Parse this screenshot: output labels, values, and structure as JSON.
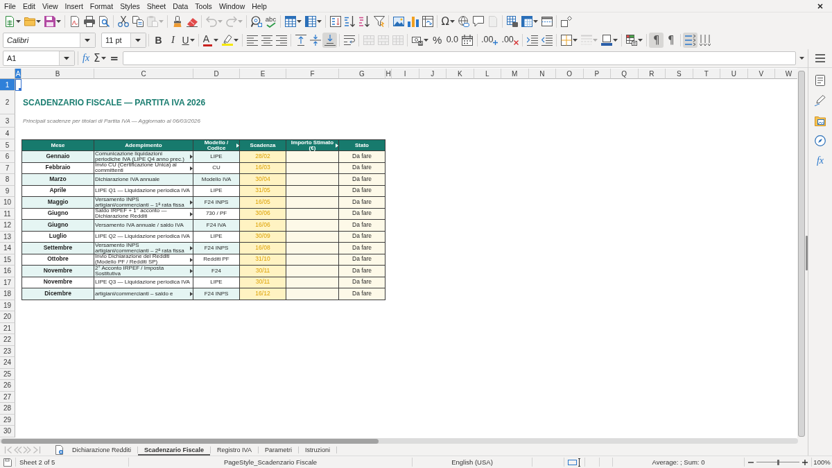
{
  "menu": [
    "File",
    "Edit",
    "View",
    "Insert",
    "Format",
    "Styles",
    "Sheet",
    "Data",
    "Tools",
    "Window",
    "Help"
  ],
  "standard_toolbar": [
    [
      {
        "kind": "new",
        "dropdown": true,
        "disabled": false,
        "on": false
      },
      {
        "kind": "open",
        "dropdown": true,
        "disabled": false,
        "on": false
      },
      {
        "kind": "save",
        "dropdown": true,
        "disabled": false,
        "on": false
      }
    ],
    [
      {
        "kind": "pdf",
        "disabled": false,
        "on": false
      },
      {
        "kind": "print",
        "disabled": false,
        "on": false
      },
      {
        "kind": "preview",
        "disabled": false,
        "on": false
      }
    ],
    [
      {
        "kind": "cut",
        "disabled": false,
        "on": false
      },
      {
        "kind": "copy",
        "disabled": false,
        "on": false
      },
      {
        "kind": "paste",
        "dropdown": true,
        "disabled": true,
        "on": false
      }
    ],
    [
      {
        "kind": "clone",
        "disabled": false,
        "on": false
      },
      {
        "kind": "clear",
        "disabled": false,
        "on": false
      }
    ],
    [
      {
        "kind": "undo",
        "dropdown": true,
        "disabled": true,
        "on": false
      },
      {
        "kind": "redo",
        "dropdown": true,
        "disabled": true,
        "on": false
      }
    ],
    [
      {
        "kind": "find",
        "disabled": false,
        "on": false
      },
      {
        "kind": "spelling",
        "label": "abc",
        "disabled": false,
        "on": false
      }
    ],
    [
      {
        "kind": "rows",
        "dropdown": true,
        "disabled": false,
        "on": false
      },
      {
        "kind": "columns",
        "dropdown": true,
        "disabled": false,
        "on": false
      }
    ],
    [
      {
        "kind": "sort",
        "disabled": false,
        "on": false
      },
      {
        "kind": "sortasc",
        "disabled": false,
        "on": false
      },
      {
        "kind": "sortdesc",
        "disabled": false,
        "on": false
      },
      {
        "kind": "autofilter",
        "disabled": false,
        "on": false
      }
    ],
    [
      {
        "kind": "image",
        "disabled": false,
        "on": false
      },
      {
        "kind": "chart",
        "disabled": false,
        "on": false
      },
      {
        "kind": "pivot",
        "disabled": false,
        "on": false
      }
    ],
    [
      {
        "kind": "special",
        "label": "Ω",
        "dropdown": true,
        "disabled": false,
        "on": false
      },
      {
        "kind": "hyperlink",
        "disabled": false,
        "on": false
      },
      {
        "kind": "comment",
        "disabled": false,
        "on": false
      },
      {
        "kind": "headerfooter",
        "disabled": true,
        "on": false
      }
    ],
    [
      {
        "kind": "printarea",
        "disabled": false,
        "on": false
      },
      {
        "kind": "freeze",
        "dropdown": true,
        "disabled": false,
        "on": false
      },
      {
        "kind": "split",
        "disabled": false,
        "on": false
      }
    ],
    [
      {
        "kind": "shapes",
        "disabled": false,
        "on": false
      }
    ]
  ],
  "formatting_toolbar": {
    "font_name": "Calibri",
    "font_size": "11 pt",
    "groups": [
      [
        {
          "kind": "bold",
          "label": "B",
          "disabled": false,
          "on": false
        },
        {
          "kind": "italic",
          "label": "I",
          "disabled": false,
          "on": false
        },
        {
          "kind": "underline",
          "label": "U",
          "dropdown": true,
          "disabled": false,
          "on": false
        }
      ],
      [
        {
          "kind": "fontcolor",
          "label": "A",
          "dropdown": true,
          "disabled": false,
          "on": false
        },
        {
          "kind": "highlight",
          "dropdown": true,
          "disabled": false,
          "on": false
        }
      ],
      [
        {
          "kind": "alignleft",
          "disabled": false,
          "on": false
        },
        {
          "kind": "aligncenter",
          "disabled": false,
          "on": false
        },
        {
          "kind": "alignright",
          "disabled": false,
          "on": false
        }
      ],
      [
        {
          "kind": "aligntop",
          "disabled": false,
          "on": false
        },
        {
          "kind": "alignmiddle",
          "disabled": false,
          "on": false
        },
        {
          "kind": "alignbottom",
          "disabled": false,
          "on": true
        }
      ],
      [
        {
          "kind": "wrap",
          "disabled": false,
          "on": false
        }
      ],
      [
        {
          "kind": "mergecenter",
          "disabled": true,
          "on": false
        },
        {
          "kind": "merge",
          "disabled": true,
          "on": false
        },
        {
          "kind": "unmerge",
          "disabled": true,
          "on": false
        }
      ],
      [
        {
          "kind": "currency",
          "dropdown": true,
          "disabled": false,
          "on": false
        },
        {
          "kind": "percent",
          "label": "%",
          "disabled": false,
          "on": false
        },
        {
          "kind": "number",
          "label": "0.0",
          "disabled": false,
          "on": false
        },
        {
          "kind": "date",
          "disabled": false,
          "on": false
        }
      ],
      [
        {
          "kind": "adddecimal",
          "label": ".00",
          "disabled": false,
          "on": false
        },
        {
          "kind": "deldecimal",
          "label": ".00",
          "disabled": false,
          "on": false
        }
      ],
      [
        {
          "kind": "indent",
          "disabled": false,
          "on": false
        },
        {
          "kind": "outdent",
          "disabled": false,
          "on": false
        }
      ],
      [
        {
          "kind": "borders",
          "dropdown": true,
          "disabled": false,
          "on": false
        },
        {
          "kind": "borderstyle",
          "dropdown": true,
          "disabled": true,
          "on": false
        },
        {
          "kind": "bordercolor",
          "dropdown": true,
          "disabled": false,
          "on": false
        }
      ],
      [
        {
          "kind": "conditional",
          "dropdown": true,
          "disabled": false,
          "on": false
        }
      ],
      [
        {
          "kind": "ltr",
          "label": "¶",
          "disabled": false,
          "on": true
        },
        {
          "kind": "rtl",
          "label": "¶",
          "disabled": false,
          "on": false
        }
      ],
      [
        {
          "kind": "textltr",
          "disabled": false,
          "on": true
        },
        {
          "kind": "textttb",
          "disabled": false,
          "on": false
        }
      ]
    ]
  },
  "formula_bar": {
    "cell_reference": "A1",
    "function_wizard": "fx",
    "sum": "Σ",
    "formula": "="
  },
  "sidebar": [
    {
      "kind": "menu"
    },
    {
      "kind": "properties"
    },
    {
      "kind": "styles"
    },
    {
      "kind": "gallery"
    },
    {
      "kind": "navigator"
    },
    {
      "kind": "functions",
      "label": "fx"
    }
  ],
  "sheet": {
    "column_headers": [
      {
        "label": "A",
        "selected": true
      },
      {
        "label": "B",
        "selected": false
      },
      {
        "label": "C",
        "selected": false
      },
      {
        "label": "D",
        "selected": false
      },
      {
        "label": "E",
        "selected": false
      },
      {
        "label": "F",
        "selected": false
      },
      {
        "label": "G",
        "selected": false
      },
      {
        "label": "H",
        "selected": false
      },
      {
        "label": "I",
        "selected": false
      },
      {
        "label": "J",
        "selected": false
      },
      {
        "label": "K",
        "selected": false
      },
      {
        "label": "L",
        "selected": false
      },
      {
        "label": "M",
        "selected": false
      },
      {
        "label": "N",
        "selected": false
      },
      {
        "label": "O",
        "selected": false
      },
      {
        "label": "P",
        "selected": false
      },
      {
        "label": "Q",
        "selected": false
      },
      {
        "label": "R",
        "selected": false
      },
      {
        "label": "S",
        "selected": false
      },
      {
        "label": "T",
        "selected": false
      },
      {
        "label": "U",
        "selected": false
      },
      {
        "label": "V",
        "selected": false
      },
      {
        "label": "W",
        "selected": false
      }
    ],
    "row_headers": [
      {
        "label": "1",
        "selected": true
      },
      {
        "label": "2",
        "selected": false
      },
      {
        "label": "3",
        "selected": false
      },
      {
        "label": "4",
        "selected": false
      },
      {
        "label": "5",
        "selected": false
      },
      {
        "label": "6",
        "selected": false
      },
      {
        "label": "7",
        "selected": false
      },
      {
        "label": "8",
        "selected": false
      },
      {
        "label": "9",
        "selected": false
      },
      {
        "label": "10",
        "selected": false
      },
      {
        "label": "11",
        "selected": false
      },
      {
        "label": "12",
        "selected": false
      },
      {
        "label": "13",
        "selected": false
      },
      {
        "label": "14",
        "selected": false
      },
      {
        "label": "15",
        "selected": false
      },
      {
        "label": "16",
        "selected": false
      },
      {
        "label": "17",
        "selected": false
      },
      {
        "label": "18",
        "selected": false
      },
      {
        "label": "19",
        "selected": false
      },
      {
        "label": "20",
        "selected": false
      },
      {
        "label": "21",
        "selected": false
      },
      {
        "label": "22",
        "selected": false
      },
      {
        "label": "23",
        "selected": false
      },
      {
        "label": "24",
        "selected": false
      },
      {
        "label": "25",
        "selected": false
      },
      {
        "label": "26",
        "selected": false
      },
      {
        "label": "27",
        "selected": false
      },
      {
        "label": "28",
        "selected": false
      },
      {
        "label": "29",
        "selected": false
      },
      {
        "label": "30",
        "selected": false
      }
    ],
    "title": "SCADENZARIO FISCALE — PARTITA IVA 2026",
    "subtitle": "Principali scadenze per titolari di Partita IVA — Aggiornato al 06/03/2026",
    "table": {
      "columns": [
        {
          "label": "Mese",
          "overflow": false
        },
        {
          "label": "Adempimento",
          "overflow": false
        },
        {
          "label": "Modello /\nCodice",
          "overflow": true
        },
        {
          "label": "Scadenza",
          "overflow": false
        },
        {
          "label": "Importo Stimato\n(€)",
          "overflow": true
        },
        {
          "label": "Stato",
          "overflow": false
        }
      ],
      "rows": [
        {
          "mese": "Gennaio",
          "adempimento": "Comunicazione liquidazioni\nperiodiche IVA (LIPE Q4 anno prec.)",
          "overflow": true,
          "modello": "LIPE",
          "scadenza": "28/02",
          "stato": "Da fare"
        },
        {
          "mese": "Febbraio",
          "adempimento": "Invio CU (Certificazione Unica) ai\ncommittenti",
          "overflow": true,
          "modello": "CU",
          "scadenza": "16/03",
          "stato": "Da fare"
        },
        {
          "mese": "Marzo",
          "adempimento": "Dichiarazione IVA annuale",
          "overflow": false,
          "modello": "Modello IVA",
          "scadenza": "30/04",
          "stato": "Da fare"
        },
        {
          "mese": "Aprile",
          "adempimento": "LIPE Q1 — Liquidazione periodica IVA",
          "overflow": false,
          "modello": "LIPE",
          "scadenza": "31/05",
          "stato": "Da fare"
        },
        {
          "mese": "Maggio",
          "adempimento": "Versamento INPS\nartigiani/commercianti – 1ª rata fissa",
          "overflow": true,
          "modello": "F24 INPS",
          "scadenza": "16/05",
          "stato": "Da fare"
        },
        {
          "mese": "Giugno",
          "adempimento": "Saldo IRPEF + 1° acconto —\nDichiarazione Redditi",
          "overflow": true,
          "modello": "730 / PF",
          "scadenza": "30/06",
          "stato": "Da fare"
        },
        {
          "mese": "Giugno",
          "adempimento": "Versamento IVA annuale / saldo IVA",
          "overflow": false,
          "modello": "F24 IVA",
          "scadenza": "16/06",
          "stato": "Da fare"
        },
        {
          "mese": "Luglio",
          "adempimento": "LIPE Q2 — Liquidazione periodica IVA",
          "overflow": false,
          "modello": "LIPE",
          "scadenza": "30/09",
          "stato": "Da fare"
        },
        {
          "mese": "Settembre",
          "adempimento": "Versamento INPS\nartigiani/commercianti – 2ª rata fissa",
          "overflow": true,
          "modello": "F24 INPS",
          "scadenza": "16/08",
          "stato": "Da fare"
        },
        {
          "mese": "Ottobre",
          "adempimento": "Invio Dichiarazione dei Redditi\n(Modello PF / Redditi SP)",
          "overflow": true,
          "modello": "Redditi PF",
          "scadenza": "31/10",
          "stato": "Da fare"
        },
        {
          "mese": "Novembre",
          "adempimento": "2° Acconto IRPEF / Imposta\nSostitutiva",
          "overflow": true,
          "modello": "F24",
          "scadenza": "30/11",
          "stato": "Da fare"
        },
        {
          "mese": "Novembre",
          "adempimento": "LIPE Q3 — Liquidazione periodica IVA",
          "overflow": false,
          "modello": "LIPE",
          "scadenza": "30/11",
          "stato": "Da fare"
        },
        {
          "mese": "Dicembre",
          "adempimento": "artigiani/commercianti – saldo e",
          "overflow": true,
          "modello": "F24 INPS",
          "scadenza": "16/12",
          "stato": "Da fare"
        }
      ]
    }
  },
  "sheet_tabs": {
    "nav": [
      {
        "kind": "first",
        "disabled": true
      },
      {
        "kind": "previous",
        "disabled": true
      },
      {
        "kind": "next",
        "disabled": true
      },
      {
        "kind": "last",
        "disabled": true
      }
    ],
    "tabs": [
      {
        "label": "Dichiarazione Redditi",
        "selected": false
      },
      {
        "label": "Scadenzario Fiscale",
        "selected": true
      },
      {
        "label": "Registro IVA",
        "selected": false
      },
      {
        "label": "Parametri",
        "selected": false
      },
      {
        "label": "Istruzioni",
        "selected": false
      }
    ]
  },
  "status_bar": {
    "sheet": "Sheet 2 of 5",
    "page_style": "PageStyle_Scadenzario Fiscale",
    "language": "English (USA)",
    "summary": "Average: ; Sum: 0",
    "zoom": {
      "level": 0.5,
      "label": "100%"
    }
  }
}
